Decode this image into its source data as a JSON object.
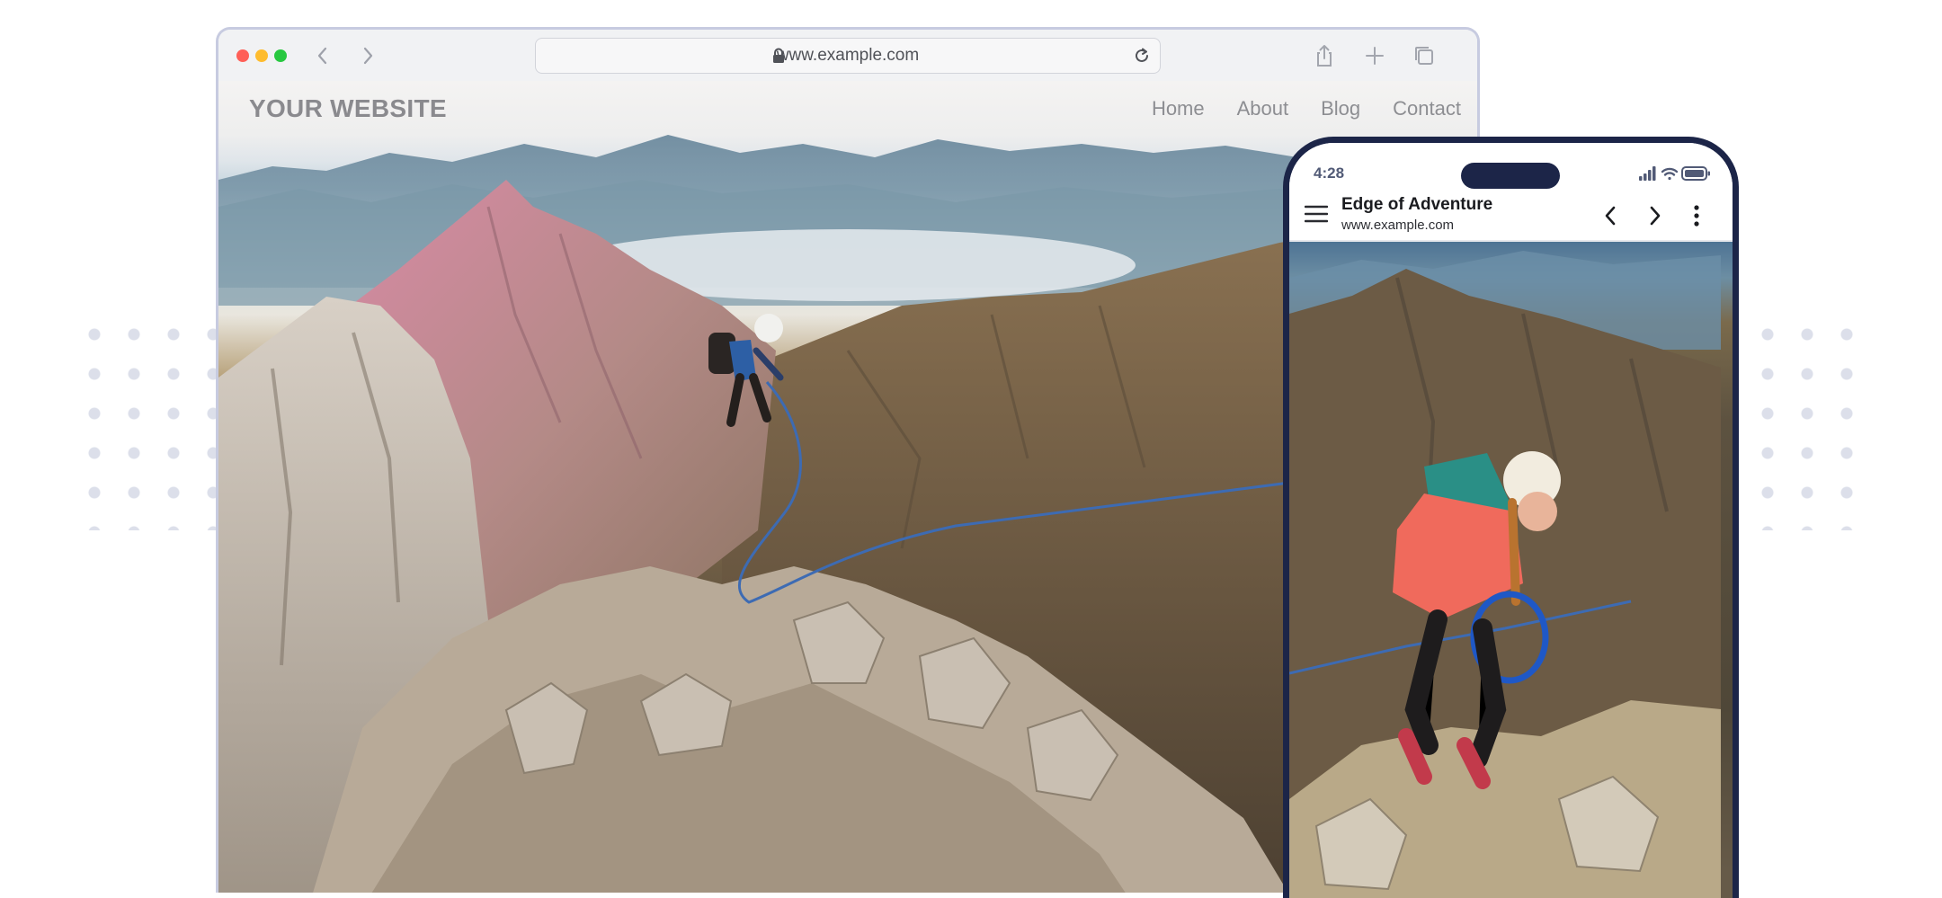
{
  "browser": {
    "url": "www.example.com",
    "icons": {
      "back": "chevron-left-icon",
      "forward": "chevron-right-icon",
      "lock": "lock-icon",
      "reload": "reload-icon",
      "share": "share-icon",
      "new_tab": "plus-icon",
      "tabs": "tabs-icon"
    }
  },
  "website": {
    "logo": "YOUR WEBSITE",
    "nav": [
      "Home",
      "About",
      "Blog",
      "Contact"
    ]
  },
  "phone": {
    "time": "4:28",
    "page_title": "Edge of Adventure",
    "page_url": "www.example.com",
    "icons": {
      "menu": "hamburger-menu-icon",
      "back": "chevron-left-icon",
      "forward": "chevron-right-icon",
      "more": "more-vertical-icon",
      "signal": "signal-icon",
      "wifi": "wifi-icon",
      "battery": "battery-icon"
    }
  },
  "colors": {
    "frame_border": "#c7cbe0",
    "phone_frame": "#1c2548",
    "site_logo": "#8a8a8e",
    "site_nav": "#8d8e92"
  }
}
